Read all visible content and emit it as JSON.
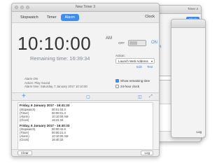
{
  "window": {
    "title": "New Timer 3"
  },
  "back_windows": {
    "title": "Timer 2",
    "tab_label": "Clock",
    "clock_button": "Clock",
    "on_label": "ON",
    "log_button": "Log"
  },
  "toolbar": {
    "tabs": [
      {
        "label": "Stopwatch",
        "active": false
      },
      {
        "label": "Timer",
        "active": false
      },
      {
        "label": "Alarm",
        "active": true
      }
    ],
    "right_label": "Clock"
  },
  "clock": {
    "time": "10:10:00",
    "ampm": "AM",
    "remaining": "Remaining time: 16:39:34"
  },
  "alarm": {
    "toggle_off_label": "OFF",
    "toggle_on_label": "ON",
    "action_label": "Action:",
    "action_value": "Launch Web Address",
    "edit_link": "Edit",
    "test_link": "Test",
    "show_remaining_label": "Show remaining time",
    "show_remaining_checked": true,
    "hour24_label": "24-hour clock",
    "hour24_checked": false
  },
  "info": {
    "line1": "Alarm ON",
    "line2": "Action: Play Sound",
    "line3": "Alarm time: Saturday, 7 January 2017 10:10:00"
  },
  "log": {
    "entries": [
      {
        "date": "Friday, 6 January 2017 - 16:41:33",
        "rows": [
          {
            "k": "(Stopwatch)",
            "v": "00:01:03.3"
          },
          {
            "k": "(Timer)",
            "v": "00:00:01.3"
          },
          {
            "k": "(Alarm)",
            "v": "10:10:00 AM"
          },
          {
            "k": "(Clock)",
            "v": "16:41:33"
          }
        ]
      },
      {
        "date": "Friday, 6 January 2017 - 16:40:33",
        "rows": [
          {
            "k": "(Stopwatch)",
            "v": "00:00:42.6"
          },
          {
            "k": "(Timer)",
            "v": "00:00:21.3"
          },
          {
            "k": "(Alarm)",
            "v": "10:10:00 AM"
          },
          {
            "k": "(Clock)",
            "v": "16:40:33"
          }
        ]
      }
    ]
  },
  "bottom": {
    "clear_button": "Clear",
    "log_button": "Log"
  },
  "colors": {
    "accent": "#3b8df5",
    "remaining_text": "#7c8aa0"
  }
}
